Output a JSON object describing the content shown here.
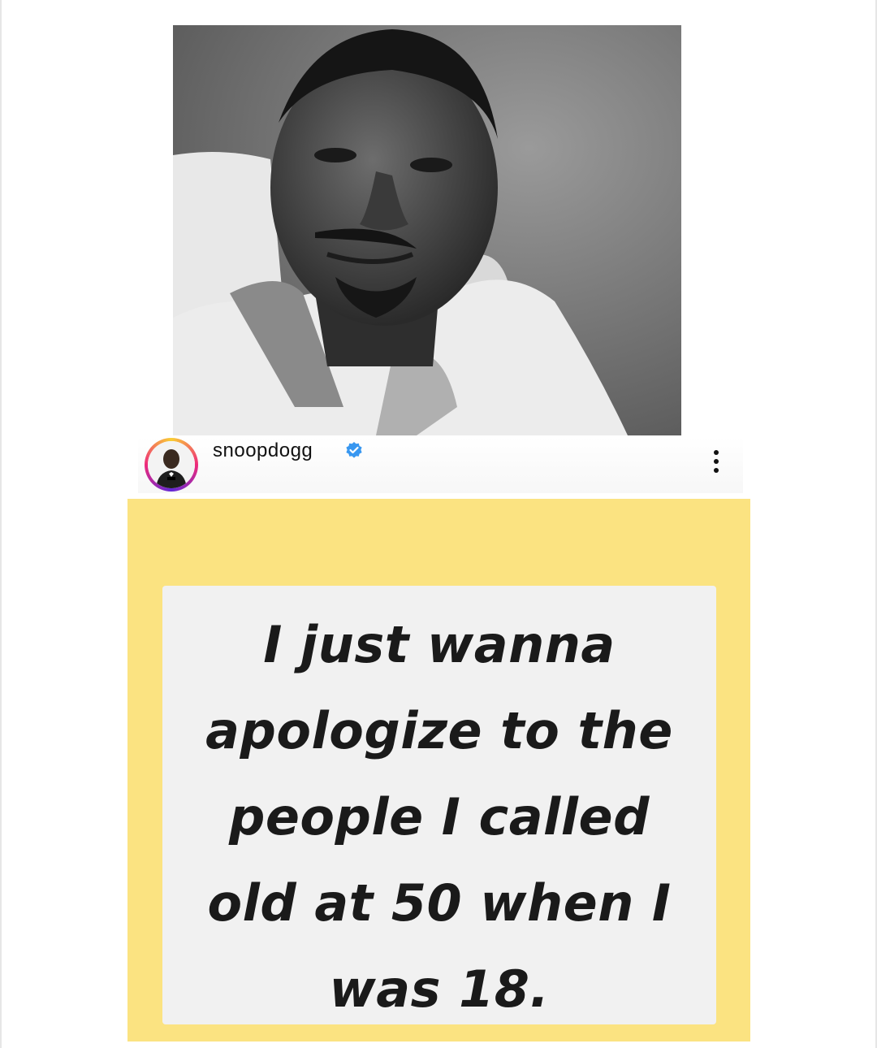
{
  "post": {
    "username": "snoopdogg",
    "verified": true,
    "verified_icon": "verified-badge-icon",
    "more_icon": "more-options-icon",
    "photo_icon": "profile-photo"
  },
  "quote": {
    "lines": [
      "I just wanna",
      "apologize to the",
      "people I called",
      "old at 50 when I",
      "was 18."
    ]
  },
  "colors": {
    "card_yellow": "#fbe381",
    "card_white": "#f1f1f1",
    "verified_blue": "#3897f0",
    "text": "#1a1a1a"
  }
}
